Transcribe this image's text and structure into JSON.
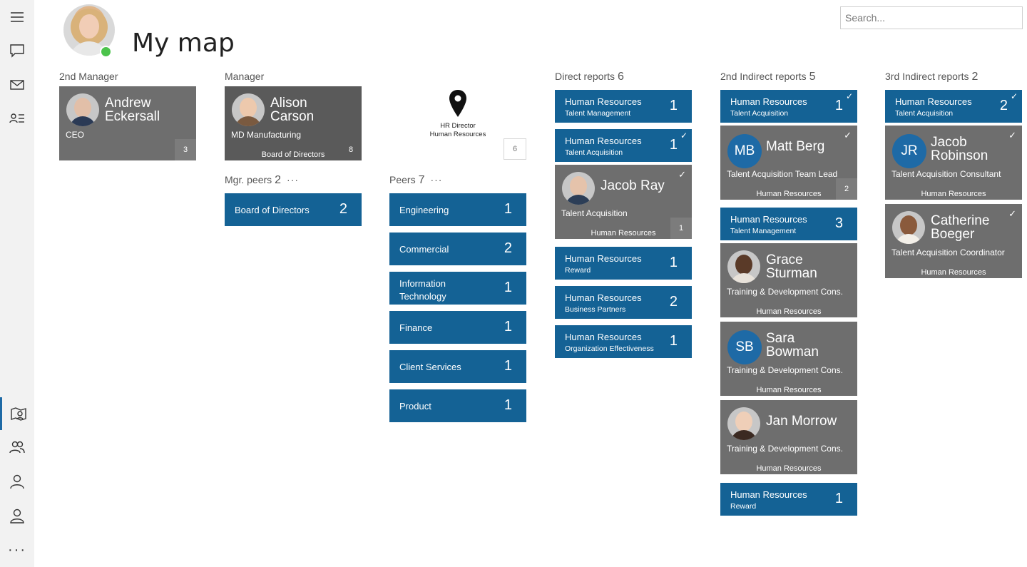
{
  "page_title": "My map",
  "search": {
    "placeholder": "Search..."
  },
  "sidebar": {
    "more": "···"
  },
  "columns": {
    "second_manager": {
      "label": "2nd Manager"
    },
    "manager": {
      "label": "Manager"
    },
    "mgr_peers": {
      "label": "Mgr. peers",
      "count": "2",
      "more": "···"
    },
    "peers": {
      "label": "Peers",
      "count": "7",
      "more": "···"
    },
    "direct": {
      "label": "Direct reports",
      "count": "6"
    },
    "indirect2": {
      "label": "2nd Indirect reports",
      "count": "5"
    },
    "indirect3": {
      "label": "3rd Indirect reports",
      "count": "2"
    }
  },
  "second_manager_card": {
    "first": "Andrew",
    "last": "Eckersall",
    "role": "CEO",
    "count": "3"
  },
  "manager_card": {
    "first": "Alison",
    "last": "Carson",
    "role": "MD Manufacturing",
    "dept": "Board of Directors",
    "count": "8"
  },
  "me": {
    "title": "HR Director",
    "dept": "Human Resources",
    "count": "6"
  },
  "mgr_peer_items": [
    {
      "label": "Board of Directors",
      "count": "2"
    }
  ],
  "peer_items": [
    {
      "label": "Engineering",
      "count": "1"
    },
    {
      "label": "Commercial",
      "count": "2"
    },
    {
      "label": "Information Technology",
      "count": "1"
    },
    {
      "label": "Finance",
      "count": "1"
    },
    {
      "label": "Client Services",
      "count": "1"
    },
    {
      "label": "Product",
      "count": "1"
    }
  ],
  "direct_items": [
    {
      "dept": "Human Resources",
      "sub": "Talent Management",
      "count": "1"
    },
    {
      "dept": "Human Resources",
      "sub": "Talent Acquisition",
      "count": "1",
      "check": "✓"
    },
    {
      "name": "Jacob Ray",
      "role": "Talent Acquisition",
      "dept": "Human Resources",
      "count": "1",
      "check": "✓"
    },
    {
      "dept": "Human Resources",
      "sub": "Reward",
      "count": "1"
    },
    {
      "dept": "Human Resources",
      "sub": "Business Partners",
      "count": "2"
    },
    {
      "dept": "Human Resources",
      "sub": "Organization Effectiveness",
      "count": "1"
    }
  ],
  "indirect2_items": [
    {
      "dept": "Human Resources",
      "sub": "Talent Acquisition",
      "count": "1",
      "check": "✓"
    },
    {
      "initials": "MB",
      "name": "Matt Berg",
      "role": "Talent Acquisition Team Lead",
      "dept": "Human Resources",
      "count": "2",
      "check": "✓"
    },
    {
      "dept": "Human Resources",
      "sub": "Talent Management",
      "count": "3"
    },
    {
      "first": "Grace",
      "last": "Sturman",
      "role": "Training & Development Cons.",
      "dept": "Human Resources"
    },
    {
      "initials": "SB",
      "first": "Sara",
      "last": "Bowman",
      "role": "Training & Development Cons.",
      "dept": "Human Resources"
    },
    {
      "name": "Jan Morrow",
      "role": "Training & Development Cons.",
      "dept": "Human Resources"
    },
    {
      "dept": "Human Resources",
      "sub": "Reward",
      "count": "1"
    }
  ],
  "indirect3_items": [
    {
      "dept": "Human Resources",
      "sub": "Talent Acquisition",
      "count": "2",
      "check": "✓"
    },
    {
      "initials": "JR",
      "first": "Jacob",
      "last": "Robinson",
      "role": "Talent Acquisition Consultant",
      "dept": "Human Resources",
      "check": "✓"
    },
    {
      "first": "Catherine",
      "last": "Boeger",
      "role": "Talent Acquisition Coordinator",
      "dept": "Human Resources",
      "check": "✓"
    }
  ],
  "colors": {
    "accent": "#146295",
    "card_gray": "#6e6e6e",
    "presence": "#4cc34c"
  }
}
